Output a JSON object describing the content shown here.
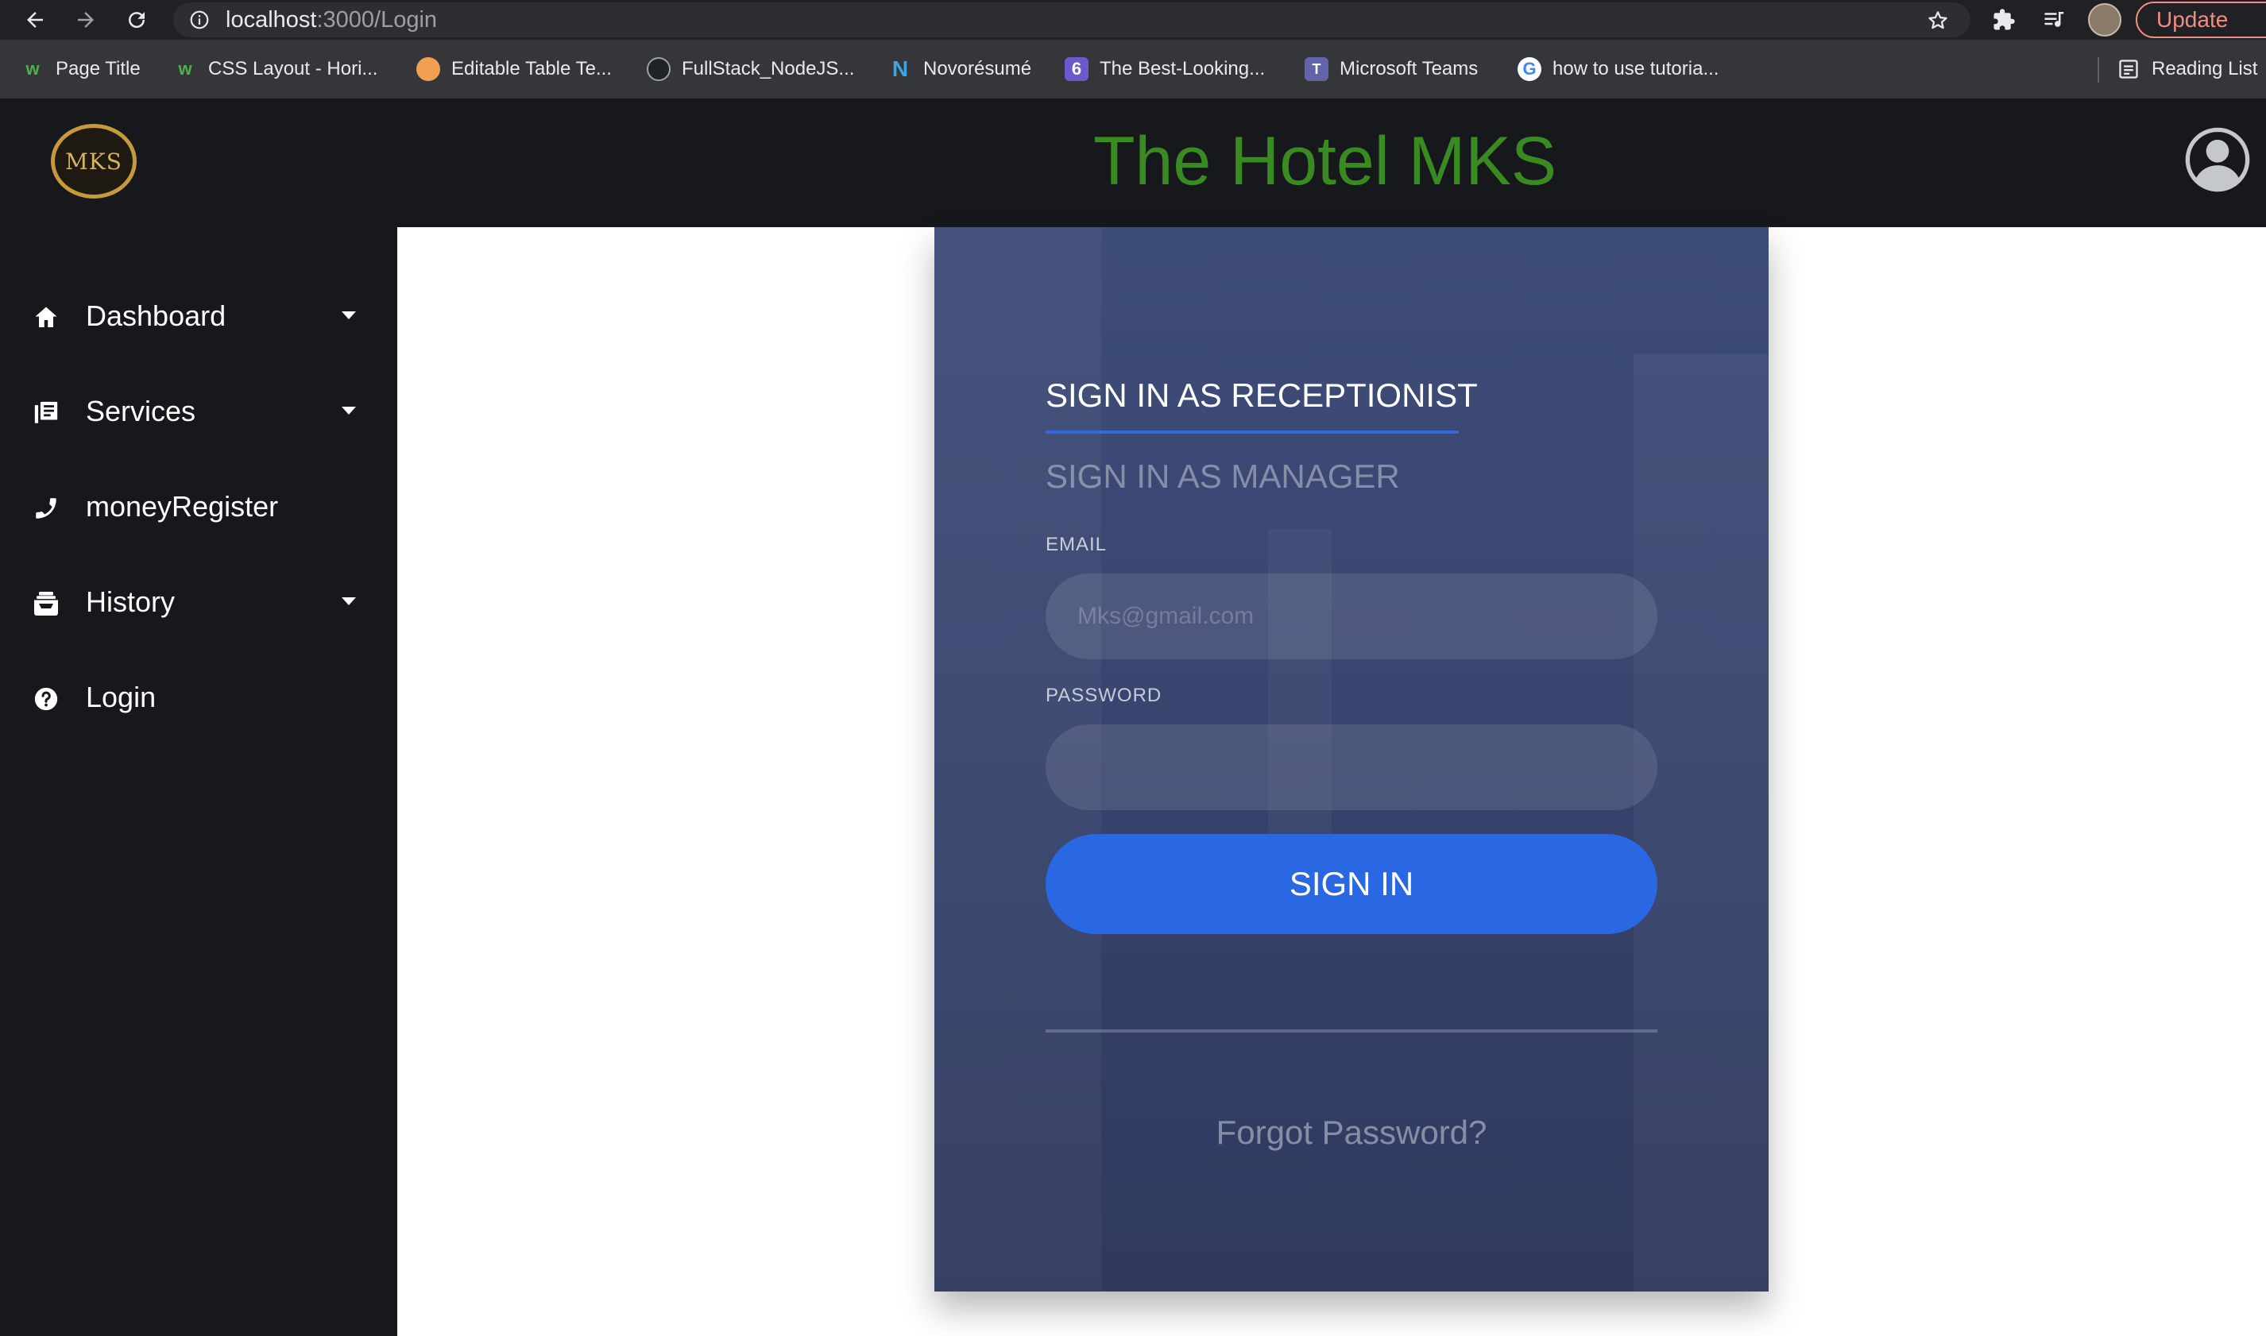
{
  "browser": {
    "url_host": "localhost",
    "url_path": ":3000/Login",
    "update_label": "Update",
    "bookmarks": [
      {
        "label": "Page Title",
        "icon": "webflow-icon",
        "color": "#4caf50"
      },
      {
        "label": "CSS Layout - Hori...",
        "icon": "webflow-icon",
        "color": "#4caf50"
      },
      {
        "label": "Editable Table Te...",
        "icon": "orange-ball-icon",
        "color": "#f0a050"
      },
      {
        "label": "FullStack_NodeJS...",
        "icon": "github-icon",
        "color": "#ffffff"
      },
      {
        "label": "Novorésumé",
        "icon": "novoresume-icon",
        "color": "#3da5e0"
      },
      {
        "label": "The Best-Looking...",
        "icon": "six-icon",
        "color": "#6a5acd"
      },
      {
        "label": "Microsoft Teams",
        "icon": "teams-icon",
        "color": "#6264a7"
      },
      {
        "label": "how to use tutoria...",
        "icon": "google-icon",
        "color": "#ffffff"
      }
    ],
    "reading_list_label": "Reading List"
  },
  "header": {
    "logo_text": "MKS",
    "title": "The Hotel MKS",
    "title_color": "#3a8a22"
  },
  "sidebar": {
    "items": [
      {
        "label": "Dashboard",
        "icon": "home-icon",
        "has_caret": true
      },
      {
        "label": "Services",
        "icon": "list-icon",
        "has_caret": true
      },
      {
        "label": "moneyRegister",
        "icon": "phone-icon",
        "has_caret": false
      },
      {
        "label": "History",
        "icon": "inbox-icon",
        "has_caret": true
      },
      {
        "label": "Login",
        "icon": "help-icon",
        "has_caret": false
      }
    ]
  },
  "login": {
    "tab_receptionist": "SIGN IN AS RECEPTIONIST",
    "tab_manager": "SIGN IN AS MANAGER",
    "email_label": "EMAIL",
    "email_placeholder": "Mks@gmail.com",
    "password_label": "PASSWORD",
    "signin_label": "SIGN IN",
    "forgot_label": "Forgot Password?",
    "accent_color": "#2967e3"
  }
}
